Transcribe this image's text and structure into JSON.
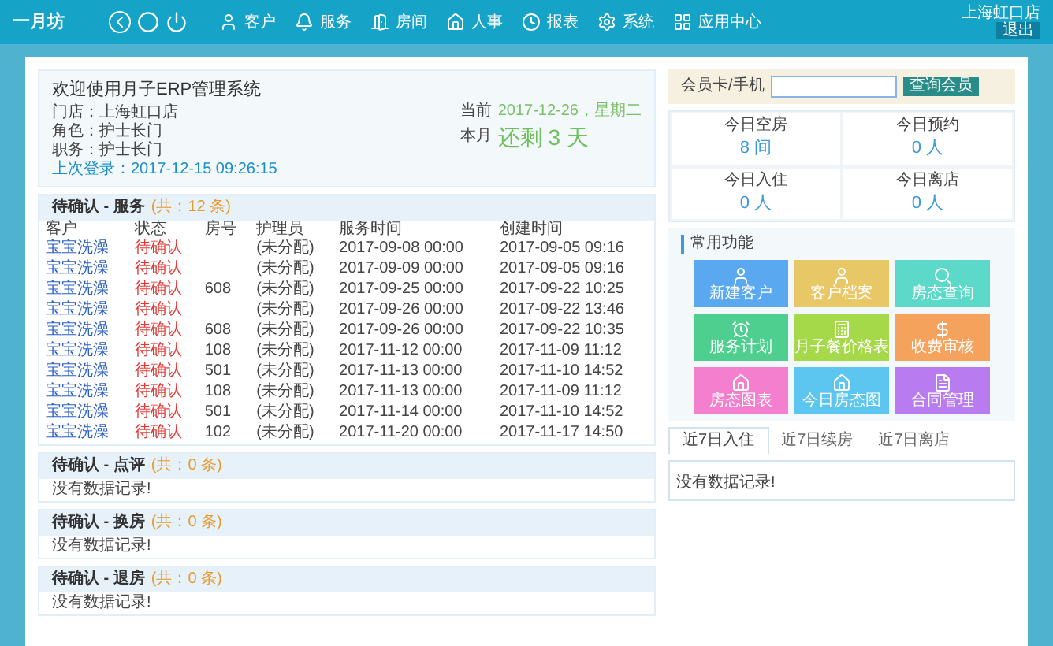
{
  "nav": {
    "logo": "一月坊",
    "items": [
      {
        "label": "客户"
      },
      {
        "label": "服务"
      },
      {
        "label": "房间"
      },
      {
        "label": "人事"
      },
      {
        "label": "报表"
      },
      {
        "label": "系统"
      },
      {
        "label": "应用中心"
      }
    ],
    "store": "上海虹口店",
    "logout": "退出"
  },
  "welcome": {
    "title": "欢迎使用月子ERP管理系统",
    "lines": [
      "门店：上海虹口店",
      "角色：护士长门",
      "职务：护士长门"
    ],
    "last_login": "上次登录：2017-12-15 09:26:15",
    "date_label": "当前",
    "date": "2017-12-26，星期二",
    "month_label": "本月",
    "remaining": "还剩 3 天"
  },
  "service_table": {
    "title": "待确认 - 服务",
    "count": "(共：12 条)",
    "columns": [
      "客户",
      "状态",
      "房号",
      "护理员",
      "服务时间",
      "创建时间"
    ],
    "rows": [
      {
        "name": "宝宝洗澡",
        "status": "待确认",
        "staff": "(未分配)",
        "service_time": "2017-09-08 00:00",
        "created": "2017-09-05 09:16"
      },
      {
        "name": "宝宝洗澡",
        "status": "待确认",
        "staff": "(未分配)",
        "service_time": "2017-09-09 00:00",
        "created": "2017-09-05 09:16"
      },
      {
        "name": "宝宝洗澡",
        "status": "待确认",
        "room": "608",
        "staff": "(未分配)",
        "service_time": "2017-09-25 00:00",
        "created": "2017-09-22 10:25"
      },
      {
        "name": "宝宝洗澡",
        "status": "待确认",
        "staff": "(未分配)",
        "service_time": "2017-09-26 00:00",
        "created": "2017-09-22 13:46"
      },
      {
        "name": "宝宝洗澡",
        "status": "待确认",
        "room": "608",
        "staff": "(未分配)",
        "service_time": "2017-09-26 00:00",
        "created": "2017-09-22 10:35"
      },
      {
        "name": "宝宝洗澡",
        "status": "待确认",
        "room": "108",
        "staff": "(未分配)",
        "service_time": "2017-11-12 00:00",
        "created": "2017-11-09 11:12"
      },
      {
        "name": "宝宝洗澡",
        "status": "待确认",
        "room": "501",
        "staff": "(未分配)",
        "service_time": "2017-11-13 00:00",
        "created": "2017-11-10 14:52"
      },
      {
        "name": "宝宝洗澡",
        "status": "待确认",
        "room": "108",
        "staff": "(未分配)",
        "service_time": "2017-11-13 00:00",
        "created": "2017-11-09 11:12"
      },
      {
        "name": "宝宝洗澡",
        "status": "待确认",
        "room": "501",
        "staff": "(未分配)",
        "service_time": "2017-11-14 00:00",
        "created": "2017-11-10 14:52"
      },
      {
        "name": "宝宝洗澡",
        "status": "待确认",
        "room": "102",
        "staff": "(未分配)",
        "service_time": "2017-11-20 00:00",
        "created": "2017-11-17 14:50"
      }
    ]
  },
  "empty_sections": [
    {
      "title": "待确认 - 点评",
      "count": "(共：0 条)",
      "message": "没有数据记录!"
    },
    {
      "title": "待确认 - 换房",
      "count": "(共：0 条)",
      "message": "没有数据记录!"
    },
    {
      "title": "待确认 - 退房",
      "count": "(共：0 条)",
      "message": "没有数据记录!"
    }
  ],
  "search": {
    "label": "会员卡/手机",
    "button": "查询会员"
  },
  "stats": [
    {
      "label": "今日空房",
      "value": "8 间"
    },
    {
      "label": "今日预约",
      "value": "0 人"
    },
    {
      "label": "今日入住",
      "value": "0 人"
    },
    {
      "label": "今日离店",
      "value": "0 人"
    }
  ],
  "shortcuts": {
    "title": "常用功能",
    "items": [
      {
        "label": "新建客户",
        "color": "#5aa9f0"
      },
      {
        "label": "客户档案",
        "color": "#e8c766"
      },
      {
        "label": "房态查询",
        "color": "#5cd9c9"
      },
      {
        "label": "服务计划",
        "color": "#4fcf8f"
      },
      {
        "label": "月子餐价格表",
        "color": "#a6d94a"
      },
      {
        "label": "收费审核",
        "color": "#f5a35c"
      },
      {
        "label": "房态图表",
        "color": "#f57fcf"
      },
      {
        "label": "今日房态图",
        "color": "#5cc6f0"
      },
      {
        "label": "合同管理",
        "color": "#b87cf0"
      }
    ]
  },
  "recent_tabs": [
    {
      "label": "近7日入住",
      "selected": true
    },
    {
      "label": "近7日续房",
      "selected": false
    },
    {
      "label": "近7日离店",
      "selected": false
    }
  ],
  "recent_message": "没有数据记录!"
}
